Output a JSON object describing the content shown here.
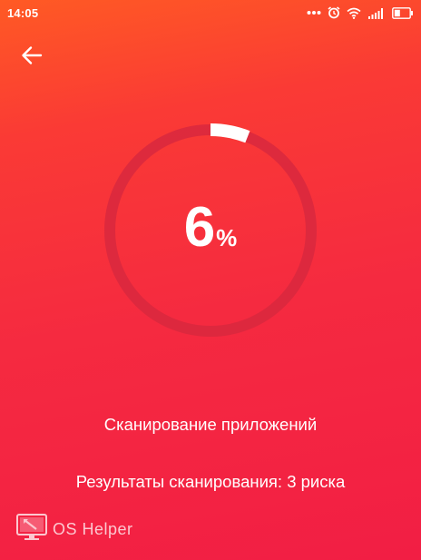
{
  "status_bar": {
    "time": "14:05"
  },
  "scan": {
    "progress": 6,
    "progress_unit": "%",
    "status_text": "Сканирование приложений",
    "results_text": "Результаты сканирования: 3 риска"
  },
  "watermark": {
    "text": "OS Helper"
  },
  "colors": {
    "background_top": "#ff5a24",
    "background_bottom": "#f21e44",
    "ring_track": "#d8283e",
    "ring_fill": "#ffffff",
    "text": "#ffffff"
  },
  "icons": {
    "status": [
      "more-dots-icon",
      "alarm-icon",
      "wifi-icon",
      "signal-icon",
      "battery-icon"
    ],
    "back": "arrow-left-icon",
    "watermark": "monitor-logo-icon"
  }
}
